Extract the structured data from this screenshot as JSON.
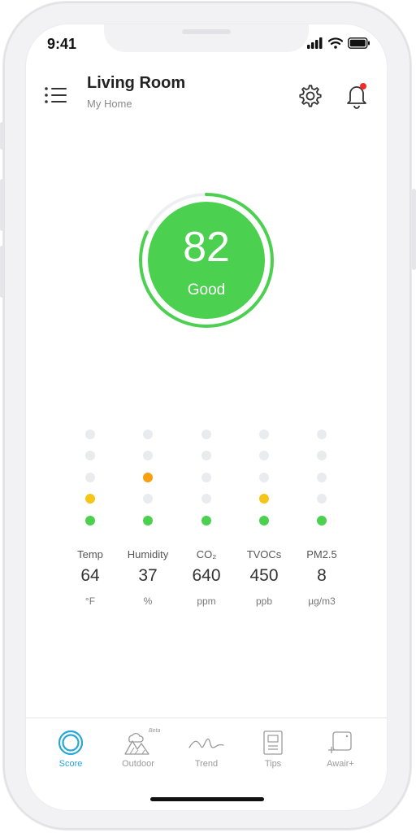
{
  "status": {
    "time": "9:41"
  },
  "header": {
    "title": "Living Room",
    "subtitle": "My Home"
  },
  "score": {
    "value": "82",
    "label": "Good",
    "level": 82,
    "color": "#4cd04f"
  },
  "sensors": [
    {
      "name": "Temp",
      "value": "64",
      "unit": "°F",
      "active_level": 2,
      "top_color": "#f5c518"
    },
    {
      "name": "Humidity",
      "value": "37",
      "unit": "%",
      "active_level": 3,
      "top_color": "#f5a011"
    },
    {
      "name": "CO₂",
      "value": "640",
      "unit": "ppm",
      "active_level": 1,
      "top_color": "#4cd04f"
    },
    {
      "name": "TVOCs",
      "value": "450",
      "unit": "ppb",
      "active_level": 2,
      "top_color": "#f5c518"
    },
    {
      "name": "PM2.5",
      "value": "8",
      "unit": "µg/m3",
      "active_level": 1,
      "top_color": "#4cd04f"
    }
  ],
  "colors": {
    "green": "#4cd04f",
    "yellow": "#f5c518",
    "orange": "#f5a011",
    "inactive": "#e9ecef",
    "accent": "#28a6d6"
  },
  "tabs": [
    {
      "label": "Score",
      "icon": "score-icon",
      "active": true
    },
    {
      "label": "Outdoor",
      "icon": "outdoor-icon",
      "badge": "Beta",
      "active": false
    },
    {
      "label": "Trend",
      "icon": "trend-icon",
      "active": false
    },
    {
      "label": "Tips",
      "icon": "tips-icon",
      "active": false
    },
    {
      "label": "Awair+",
      "icon": "awair-plus-icon",
      "active": false
    }
  ]
}
